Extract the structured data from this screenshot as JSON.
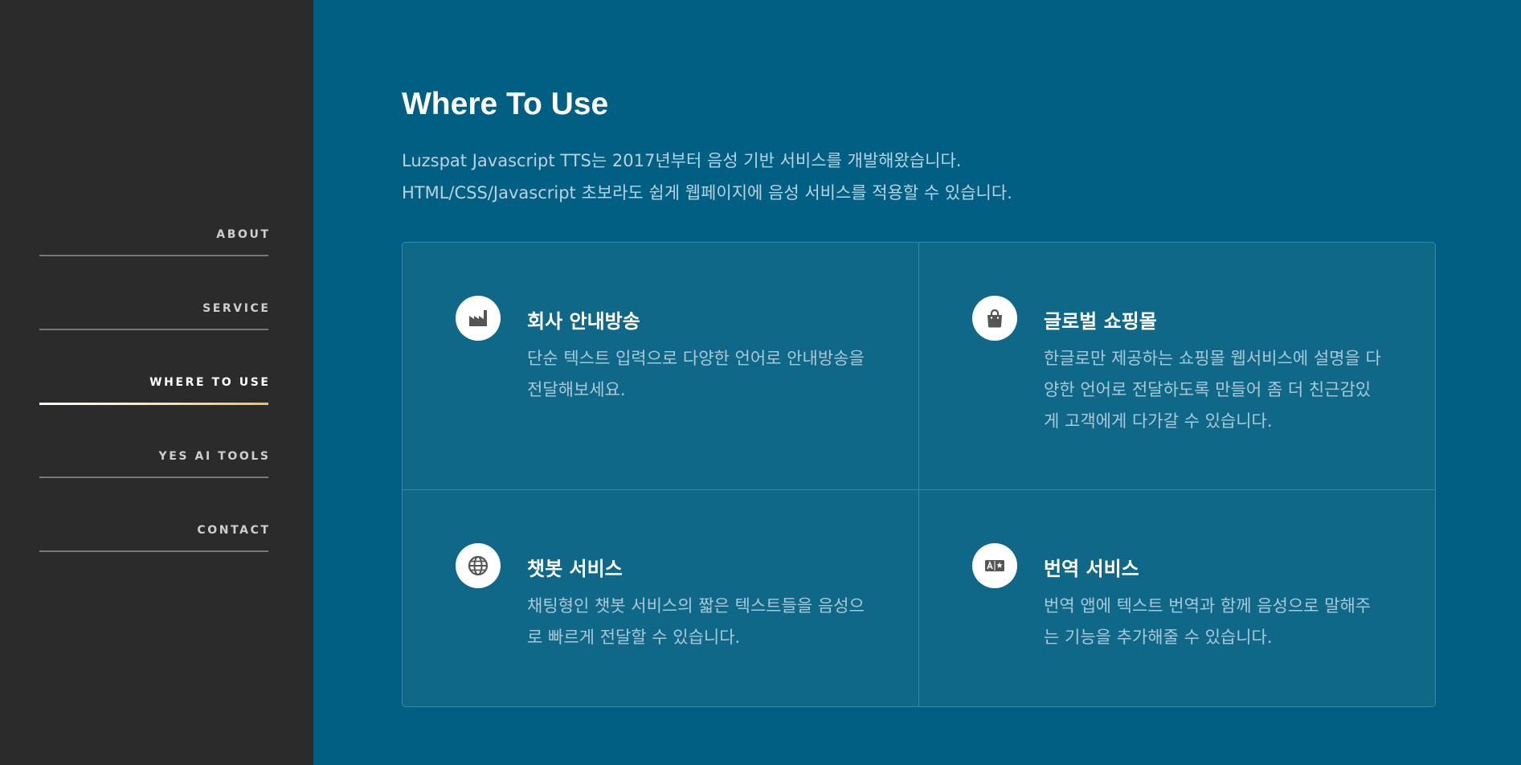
{
  "nav": {
    "items": [
      {
        "label": "ABOUT"
      },
      {
        "label": "SERVICE"
      },
      {
        "label": "WHERE TO USE"
      },
      {
        "label": "YES AI TOOLS"
      },
      {
        "label": "CONTACT"
      }
    ],
    "active": "WHERE TO USE"
  },
  "section": {
    "title": "Where To Use",
    "intro_line1": "Luzspat Javascript TTS는 2017년부터 음성 기반 서비스를 개발해왔습니다.",
    "intro_line2": "HTML/CSS/Javascript 초보라도 쉽게 웹페이지에 음성 서비스를 적용할 수 있습니다."
  },
  "cards": [
    {
      "icon": "factory-icon",
      "title": "회사 안내방송",
      "desc": "단순 텍스트 입력으로 다양한 언어로 안내방송을 전달해보세요."
    },
    {
      "icon": "shopping-bag-icon",
      "title": "글로벌 쇼핑몰",
      "desc": "한글로만 제공하는 쇼핑몰 웹서비스에 설명을 다양한 언어로 전달하도록 만들어 좀 더 친근감있게 고객에게 다가갈 수 있습니다."
    },
    {
      "icon": "globe-icon",
      "title": "챗봇 서비스",
      "desc": "채팅형인 챗봇 서비스의 짧은 텍스트들을 음성으로 빠르게 전달할 수 있습니다."
    },
    {
      "icon": "translate-icon",
      "title": "번역 서비스",
      "desc": "번역 앱에 텍스트 번역과 함께 음성으로 말해주는 기능을 추가해줄 수 있습니다."
    }
  ],
  "colors": {
    "sidebar_bg": "#2b2b2b",
    "main_bg": "#005f83",
    "card_bg": "#0f6888",
    "icon_fill": "#555555",
    "active_underline": "#f3c05a"
  }
}
